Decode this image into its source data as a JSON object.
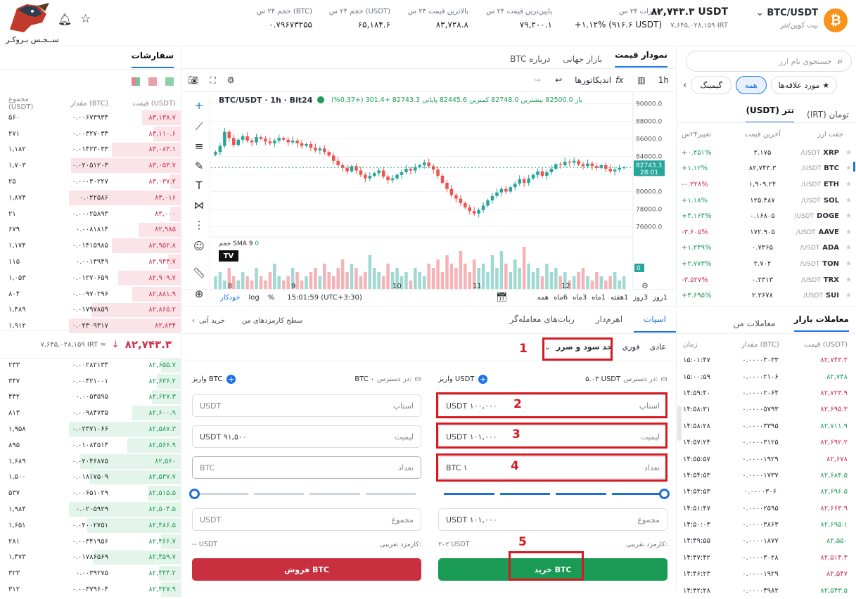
{
  "logo": {
    "brand": "ســجـس بـروکـر"
  },
  "header": {
    "pair": "BTC/USDT",
    "pair_sub": "بیت کوین/تتر",
    "price_usdt": "۸۲,۷۴۳.۳ USDT",
    "price_irt": "۷,۶۴۵,۰۲۸,۱۵۹ IRT",
    "change_label": "تغییرات ۲۴ س",
    "change_value": "+۱.۱۲% (۹۱۶.۶ USDT)",
    "low_label": "پایین‌ترین قیمت ۲۴ س",
    "low_value": "۷۹,۲۰۰.۱",
    "high_label": "بالاترین قیمت ۲۴ س",
    "high_value": "۸۳,۷۲۸.۸",
    "vol_usdt_label": "حجم ۲۴ س (USDT)",
    "vol_usdt_value": "۶۵,۱۸۴.۶",
    "vol_btc_label": "حجم ۲۴ س (BTC)",
    "vol_btc_value": "۰.۷۹۶۷۳۲۵۵"
  },
  "orderbook": {
    "title": "سفارشات",
    "col_price": "قیمت (USDT)",
    "col_amount": "مقدار (BTC)",
    "col_total": "مجموع (USDT)",
    "asks": [
      {
        "p": "۸۳,۱۳۸.۷",
        "a": "۰.۰۰۶۷۳۹۳۴",
        "t": "۵۶۰",
        "d": 0.35
      },
      {
        "p": "۸۳,۱۱۰.۶",
        "a": "۰.۰۰۳۲۷۰۳۴",
        "t": "۲۷۱",
        "d": 0.25
      },
      {
        "p": "۸۳,۰۸۳.۱",
        "a": "۰.۰۱۴۲۳۰۳۳",
        "t": "۱,۱۸۲",
        "d": 0.62
      },
      {
        "p": "۸۳,۰۵۳.۷",
        "a": "۰.۰۲۰۵۱۲۰۳",
        "t": "۱,۷۰۳",
        "d": 0.98
      },
      {
        "p": "۸۳,۰۳۷.۲",
        "a": "۰.۰۰۰۳۰۲۲۷",
        "t": "۲۵",
        "d": 0.1
      },
      {
        "p": "۸۳,۰۱۶",
        "a": "۰.۰۲۲۵۸۶",
        "t": "۱,۸۷۴",
        "d": 1.0
      },
      {
        "p": "۸۳,۰۰۰",
        "a": "۰.۰۰۰۲۵۸۹۳",
        "t": "۲۱",
        "d": 0.1
      },
      {
        "p": "۸۲,۹۸۵",
        "a": "۰.۰۰۸۱۸۱۴",
        "t": "۶۷۹",
        "d": 0.38
      },
      {
        "p": "۸۲,۹۵۲.۸",
        "a": "۰.۰۱۴۱۵۹۸۵",
        "t": "۱,۱۷۴",
        "d": 0.62
      },
      {
        "p": "۸۲,۹۴۴.۷",
        "a": "۰.۰۰۱۳۹۴۹",
        "t": "۱۱۵",
        "d": 0.12
      },
      {
        "p": "۸۲,۹۰۹.۷",
        "a": "۰.۰۱۲۷۰۶۵۹",
        "t": "۱,۰۵۳",
        "d": 0.56
      },
      {
        "p": "۸۲,۸۸۱.۹",
        "a": "۰.۰۰۹۷۰۲۹۶",
        "t": "۸۰۴",
        "d": 0.44
      },
      {
        "p": "۸۲,۸۶۵.۲",
        "a": "۰.۰۱۷۹۷۸۵۹",
        "t": "۱,۴۸۹",
        "d": 0.8
      },
      {
        "p": "۸۲,۸۳۴",
        "a": "۰.۰۲۳۰۹۳۱۷",
        "t": "۱,۹۱۲",
        "d": 1.0
      }
    ],
    "mid_price": "۸۲,۷۴۳.۳",
    "mid_irt": "۷,۶۴۵,۰۲۸,۱۵۹ IRT ≈",
    "bids": [
      {
        "p": "۸۲,۶۵۵.۷",
        "a": "۰.۰۰۲۸۲۱۳۴",
        "t": "۲۳۳",
        "d": 0.18
      },
      {
        "p": "۸۲,۶۳۶.۲",
        "a": "۰.۰۰۴۲۱۰۰۱",
        "t": "۳۴۷",
        "d": 0.22
      },
      {
        "p": "۸۲,۶۲۷.۳",
        "a": "۰.۰۰۵۳۵۹۵",
        "t": "۴۴۲",
        "d": 0.26
      },
      {
        "p": "۸۲,۶۰۰.۹",
        "a": "۰.۰۰۹۸۴۷۳۵",
        "t": "۸۱۳",
        "d": 0.44
      },
      {
        "p": "۸۲,۵۸۷.۳",
        "a": "۰.۰۲۳۷۱۰۶۶",
        "t": "۱,۹۵۸",
        "d": 1.0
      },
      {
        "p": "۸۲,۵۶۶.۹",
        "a": "۰.۰۱۰۸۴۵۱۴",
        "t": "۸۹۵",
        "d": 0.48
      },
      {
        "p": "۸۲,۵۶۰",
        "a": "۰.۰۲۰۴۶۸۷۵",
        "t": "۱,۶۸۹",
        "d": 0.9
      },
      {
        "p": "۸۲,۵۳۷.۷",
        "a": "۰.۰۱۸۱۷۵۰۹",
        "t": "۱,۵۰۰",
        "d": 0.82
      },
      {
        "p": "۸۲,۵۱۵.۵",
        "a": "۰.۰۰۶۵۱۰۲۹",
        "t": "۵۳۷",
        "d": 0.3
      },
      {
        "p": "۸۲,۵۰۴.۵",
        "a": "۰.۰۲۰۵۹۲۹",
        "t": "۱,۹۸۴",
        "d": 1.0
      },
      {
        "p": "۸۲,۴۸۶.۵",
        "a": "۰.۰۲۰۰۲۷۵۱",
        "t": "۱,۶۵۱",
        "d": 0.84
      },
      {
        "p": "۸۲,۴۶۶.۷",
        "a": "۰.۰۰۳۴۱۹۵۶",
        "t": "۲۸۱",
        "d": 0.18
      },
      {
        "p": "۸۲,۴۵۹.۷",
        "a": "۰.۰۱۷۸۶۵۶۹",
        "t": "۱,۴۷۳",
        "d": 0.78
      },
      {
        "p": "۸۲,۴۴۴.۲",
        "a": "۰.۰۰۳۹۲۷۵",
        "t": "۳۲۳",
        "d": 0.2
      },
      {
        "p": "۸۲,۴۲۷.۹",
        "a": "۰.۰۰۳۷۹۶۰۴",
        "t": "۳۱۲",
        "d": 0.18
      }
    ]
  },
  "market": {
    "search_placeholder": "جستجوی نام ارز",
    "chips": [
      "مورد علاقه‌ها",
      "همه",
      "گیمینگ"
    ],
    "quote_tabs": [
      "تتر (USDT)",
      "تومان (IRT)"
    ],
    "col_pair": "جفت ارز",
    "col_last": "آخرین قیمت",
    "col_change": "تغییر۲۴س",
    "rows": [
      {
        "base": "XRP",
        "q": "/USDT",
        "last": "۲.۱۷۵",
        "chg": "+۰.۲۵۱%",
        "up": true
      },
      {
        "base": "BTC",
        "q": "/USDT",
        "last": "۸۲,۷۴۳.۳",
        "chg": "+۱.۱۲%",
        "up": true
      },
      {
        "base": "ETH",
        "q": "/USDT",
        "last": "۱,۹۰۹.۲۴",
        "chg": "-۰.۳۲۸%",
        "up": false
      },
      {
        "base": "SOL",
        "q": "/USDT",
        "last": "۱۲۵.۴۸۷",
        "chg": "+۱.۱۸%",
        "up": true
      },
      {
        "base": "DOGE",
        "q": "/USDT",
        "last": "۰.۱۶۸۰۵",
        "chg": "+۴.۱۶۴%",
        "up": true
      },
      {
        "base": "AAVE",
        "q": "/USDT",
        "last": "۱۷۲.۹۰۵",
        "chg": "-۳.۶۰۵%",
        "up": false
      },
      {
        "base": "ADA",
        "q": "/USDT",
        "last": "۰.۷۳۶۵",
        "chg": "+۱.۲۴۹%",
        "up": true
      },
      {
        "base": "TON",
        "q": "/USDT",
        "last": "۲.۷۰۲",
        "chg": "+۲.۷۷۳%",
        "up": true
      },
      {
        "base": "TRX",
        "q": "/USDT",
        "last": "۰.۲۳۱۳",
        "chg": "-۳.۵۲۷%",
        "up": false
      },
      {
        "base": "SUI",
        "q": "/USDT",
        "last": "۲.۲۶۷۸",
        "chg": "+۳.۶۹۵%",
        "up": true
      }
    ]
  },
  "trades": {
    "tabs": [
      "معاملات بازار",
      "معاملات من"
    ],
    "col_price": "قیمت (USDT)",
    "col_amount": "مقدار (BTC)",
    "col_time": "زمان",
    "rows": [
      {
        "p": "۸۲,۷۴۳.۳",
        "a": "۰.۰۰۰۰۳۰۳۳",
        "t": "۱۵:۰۱:۴۷",
        "up": false
      },
      {
        "p": "۸۲,۷۴۸",
        "a": "۰.۰۰۰۰۲۱۰۶",
        "t": "۱۵:۰۰:۵۹",
        "up": true
      },
      {
        "p": "۸۲,۷۲۳.۹",
        "a": "۰.۰۰۰۰۲۰۶۴",
        "t": "۱۴:۵۹:۴۰",
        "up": false
      },
      {
        "p": "۸۲,۶۹۵.۳",
        "a": "۰.۰۰۰۰۵۷۹۳",
        "t": "۱۴:۵۸:۳۱",
        "up": false
      },
      {
        "p": "۸۲,۷۱۱.۹",
        "a": "۰.۰۰۰۰۳۳۹۵",
        "t": "۱۴:۵۸:۲۸",
        "up": true
      },
      {
        "p": "۸۲,۶۹۲.۲",
        "a": "۰.۰۰۰۰۳۱۲۵",
        "t": "۱۴:۵۷:۲۴",
        "up": false
      },
      {
        "p": "۸۲,۶۷۸",
        "a": "۰.۰۰۰۰۱۹۲۹",
        "t": "۱۴:۵۵:۵۷",
        "up": false
      },
      {
        "p": "۸۲,۶۸۴.۵",
        "a": "۰.۰۰۰۰۱۷۳۷",
        "t": "۱۴:۵۴:۵۳",
        "up": true
      },
      {
        "p": "۸۲,۶۹۶.۵",
        "a": "۰.۰۰۰۰۳۰۶",
        "t": "۱۴:۵۳:۵۳",
        "up": true
      },
      {
        "p": "۸۲,۶۶۳.۹",
        "a": "۰.۰۰۰۰۲۵۹۵",
        "t": "۱۴:۵۱:۴۷",
        "up": false
      },
      {
        "p": "۸۲,۶۹۵.۱",
        "a": "۰.۰۰۰۰۳۸۶۳",
        "t": "۱۴:۵۰:۰۳",
        "up": true
      },
      {
        "p": "۸۲,۵۵۰",
        "a": "۰.۰۰۰۰۱۸۷۷",
        "t": "۱۴:۴۹:۵۵",
        "up": true
      },
      {
        "p": "۸۲,۵۱۴.۳",
        "a": "۰.۰۰۰۰۳۰۲۸",
        "t": "۱۴:۴۷:۴۲",
        "up": false
      },
      {
        "p": "۸۲,۵۴۷",
        "a": "۰.۰۰۰۰۱۹۲۹",
        "t": "۱۴:۴۶:۲۳",
        "up": false
      },
      {
        "p": "۸۲,۵۴۳.۵",
        "a": "۰.۰۰۰۰۴۹۸۲",
        "t": "۱۴:۴۲:۲۸",
        "up": true
      }
    ]
  },
  "chart_tabs": [
    "نمودار قیمت",
    "بازار جهانی",
    "درباره BTC"
  ],
  "chart_toolbar": {
    "interval": "1h",
    "indicators": "اندیکاتورها"
  },
  "chart": {
    "legend_symbol": "BTC/USDT · 1h · Bit24",
    "legend_ohlc": "باز 82500.0  بیشترین 82748.0  کمترین 82445.6  پایانی 82743.3  +301.4 (+0.37%)",
    "sma": "SMA 9",
    "sma_val": "0",
    "volume_label": "حجم",
    "volume_val": "0",
    "price_tag": "82743.3",
    "price_tag_time": "28:01",
    "y_ticks": [
      "90000.0",
      "88000.0",
      "86000.0",
      "84000.0",
      "82000.0",
      "80000.0",
      "78000.0",
      "76000.0"
    ],
    "x_ticks": [
      "8",
      "9",
      "10",
      "11",
      "12"
    ],
    "ranges": [
      "1روز",
      "3روز",
      "1هفته",
      "1ماه",
      "3ماه",
      "6ماه",
      "همه"
    ],
    "time_readout": "15:01:59 (UTC+3:30)",
    "opts": [
      "%",
      "log",
      "خودکار"
    ]
  },
  "trade_form": {
    "tabs": [
      "اسپات",
      "اهرم‌دار",
      "ربات‌های معامله‌گر"
    ],
    "link1": "سطح کارمزدهای من",
    "link2": "خرید آنی",
    "type_tabs": [
      "عادی",
      "فوری"
    ],
    "type_select": "حد سود و ضرر",
    "buy": {
      "avail_label": "در دسترس:",
      "avail_value": "۵.۰۳ USDT",
      "deposit": "واریز USDT",
      "stop_label": "استاپ",
      "stop_value": "USDT ۱۰۰,۰۰۰",
      "limit_label": "لیمیت",
      "limit_value": "USDT ۱۰۱,۰۰۰",
      "qty_label": "تعداد",
      "qty_value": "BTC ۱",
      "total_label": "مجموع",
      "total_value": "USDT ۱۰۱,۰۰۰",
      "fee_label": "کارمزد تقریبی:",
      "fee_value": "۲۰۲ USDT",
      "button": "خرید BTC"
    },
    "sell": {
      "avail_label": "در دسترس:",
      "avail_value": "BTC ۰",
      "deposit": "واریز BTC",
      "stop_label": "استاپ",
      "stop_value": "USDT",
      "limit_label": "لیمیت",
      "limit_value": "USDT ۹۱,۵۰۰",
      "qty_label": "تعداد",
      "qty_value": "BTC",
      "total_label": "مجموع",
      "total_value": "USDT",
      "fee_label": "کارمزد تقریبی:",
      "fee_value": "-- USDT",
      "button": "فروش BTC"
    },
    "buy_slider": 1.0,
    "sell_slider": 0.0
  },
  "annotations": [
    "1",
    "2",
    "3",
    "4",
    "5"
  ],
  "colors": {
    "up": "#1f9d55",
    "down": "#d0304a",
    "accent": "#1a73e8",
    "buy": "#199a55",
    "sell": "#c8303f",
    "annot": "#d71920"
  },
  "chart_data": {
    "type": "candlestick",
    "symbol": "BTC/USDT",
    "interval": "1h",
    "ylim": [
      75000,
      91000
    ],
    "candles": [
      84500,
      85200,
      86800,
      86100,
      85300,
      85900,
      86300,
      85800,
      85600,
      86200,
      86000,
      85700,
      85500,
      85800,
      86100,
      85900,
      85600,
      85800,
      85500,
      85200,
      85400,
      85000,
      84700,
      84900,
      84500,
      84100,
      83500,
      83000,
      82700,
      82300,
      82900,
      82400,
      81900,
      81500,
      81800,
      82100,
      82400,
      81700,
      81300,
      81500,
      81900,
      82200,
      82600,
      82400,
      82800,
      83000,
      83300,
      82900,
      82500,
      81800,
      81000,
      80300,
      79600,
      79200,
      78700,
      78200,
      77800,
      77500,
      77900,
      78400,
      79000,
      79500,
      79900,
      80300,
      80000,
      80500,
      80900,
      81400,
      81000,
      81500,
      81900,
      82300,
      81800,
      82200,
      82600,
      83100,
      83000,
      83400,
      83300,
      83500,
      83100,
      82900,
      83200,
      82900,
      82700,
      83000,
      82600,
      82300,
      82500,
      82700,
      82743
    ],
    "volumes": [
      3,
      4,
      2,
      5,
      3,
      2,
      4,
      3,
      2,
      5,
      3,
      2,
      4,
      6,
      3,
      2,
      3,
      5,
      4,
      2,
      3,
      4,
      5,
      3,
      6,
      4,
      3,
      5,
      7,
      4,
      6,
      5,
      3,
      4,
      8,
      5,
      4,
      3,
      6,
      4,
      5,
      3,
      4,
      2,
      5,
      4,
      3,
      6,
      5,
      7,
      4,
      8,
      6,
      5,
      9,
      6,
      4,
      7,
      5,
      6,
      4,
      8,
      5,
      9,
      6,
      4,
      7,
      5,
      10,
      6,
      4,
      5,
      3,
      6,
      4,
      5,
      3,
      4,
      2,
      3,
      4,
      5,
      3,
      2,
      4,
      3,
      2,
      3,
      4,
      2,
      3
    ]
  }
}
